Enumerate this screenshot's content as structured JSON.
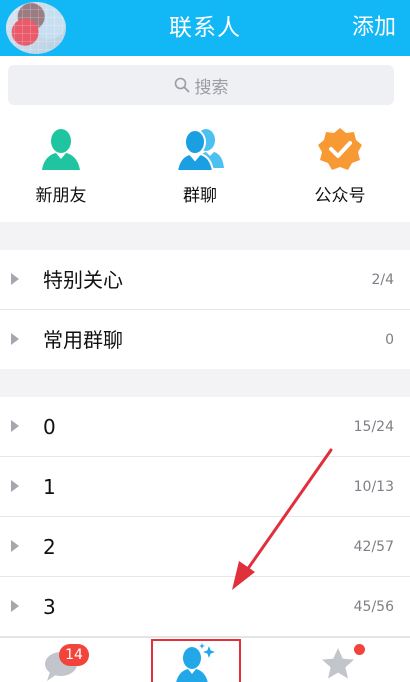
{
  "header": {
    "title": "联系人",
    "add_label": "添加"
  },
  "search": {
    "placeholder": "搜索"
  },
  "quick_entries": [
    {
      "label": "新朋友",
      "icon": "person-icon",
      "color": "#1fc4a0"
    },
    {
      "label": "群聊",
      "icon": "group-icon",
      "color": "#22a7e8"
    },
    {
      "label": "公众号",
      "icon": "verified-badge-icon",
      "color": "#f89a33"
    }
  ],
  "groups": [
    {
      "name": "特别关心",
      "count": "2/4"
    },
    {
      "name": "常用群聊",
      "count": "0"
    },
    {
      "name": "0",
      "count": "15/24"
    },
    {
      "name": "1",
      "count": "10/13"
    },
    {
      "name": "2",
      "count": "42/57"
    },
    {
      "name": "3",
      "count": "45/56"
    }
  ],
  "tabbar": {
    "messages_badge": "14",
    "active_tab": "contacts"
  },
  "colors": {
    "header": "#12b7f5",
    "accent": "#22a7e8",
    "badge": "#f2443a",
    "highlight_box": "#e0303c",
    "annotation_arrow": "#e0303c"
  }
}
